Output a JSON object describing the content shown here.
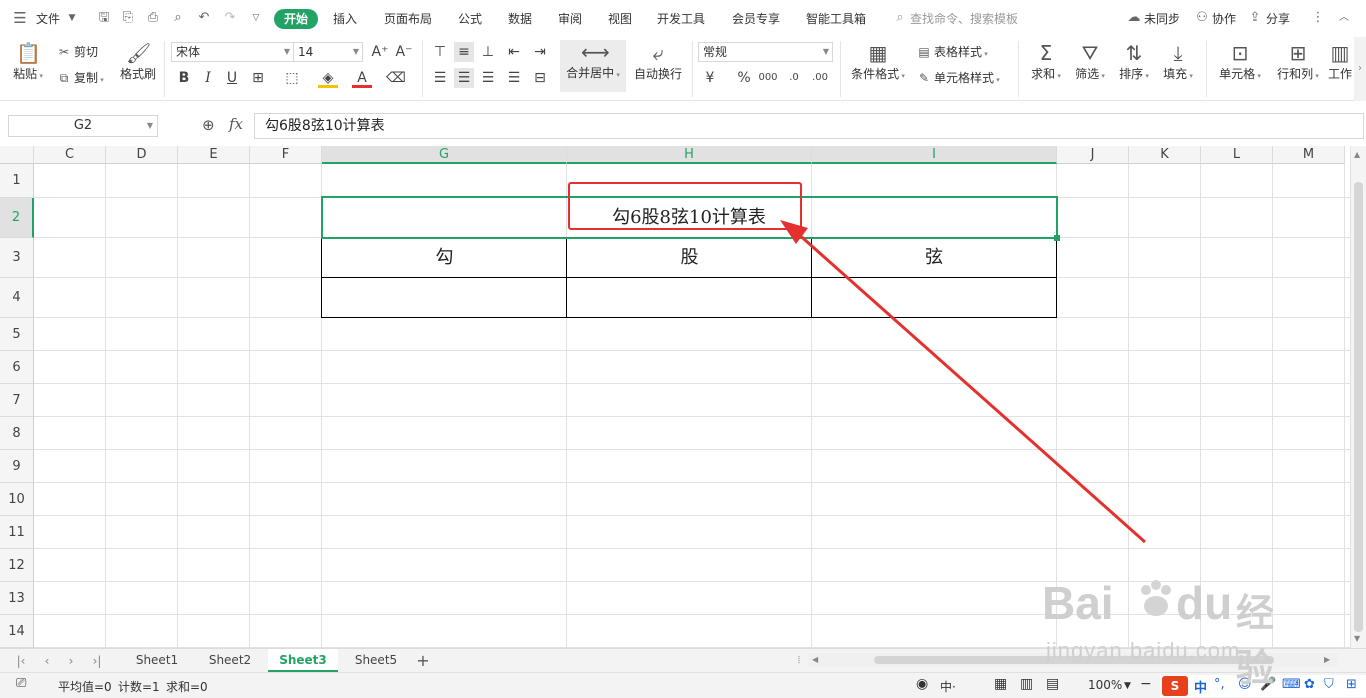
{
  "menubar": {
    "file_label": "文件",
    "tabs": [
      "开始",
      "插入",
      "页面布局",
      "公式",
      "数据",
      "审阅",
      "视图",
      "开发工具",
      "会员专享",
      "智能工具箱"
    ],
    "search_placeholder": "查找命令、搜索模板",
    "unsync_label": "未同步",
    "collab_label": "协作",
    "share_label": "分享"
  },
  "ribbon": {
    "paste": "粘贴",
    "cut": "剪切",
    "copy": "复制",
    "format_painter": "格式刷",
    "font_name": "宋体",
    "font_size": "14",
    "merge_center": "合并居中",
    "wrap_text": "自动换行",
    "number_format": "常规",
    "cond_format": "条件格式",
    "table_style": "表格样式",
    "cell_style": "单元格样式",
    "sum": "求和",
    "filter": "筛选",
    "sort": "排序",
    "fill": "填充",
    "cells": "单元格",
    "rows_cols": "行和列",
    "worksheet": "工作"
  },
  "formula_bar": {
    "cell_ref": "G2",
    "fx": "fx",
    "content": "勾6股8弦10计算表"
  },
  "grid": {
    "columns": [
      "C",
      "D",
      "E",
      "F",
      "G",
      "H",
      "I",
      "J",
      "K",
      "L",
      "M"
    ],
    "rows": [
      "1",
      "2",
      "3",
      "4",
      "5",
      "6",
      "7",
      "8",
      "9",
      "10",
      "11",
      "12",
      "13",
      "14"
    ],
    "title_cell": "勾6股8弦10计算表",
    "headers": [
      "勾",
      "股",
      "弦"
    ]
  },
  "sheets": {
    "tabs": [
      "Sheet1",
      "Sheet2",
      "Sheet3",
      "Sheet5"
    ],
    "active": "Sheet3"
  },
  "status": {
    "average": "平均值=0",
    "count": "计数=1",
    "sum": "求和=0",
    "zoom": "100%"
  },
  "watermark": {
    "brand": "Bai",
    "brand2": "du",
    "cn": "经验",
    "url": "jingyan.baidu.com"
  },
  "colors": {
    "accent": "#21a366",
    "annotation": "#e53030"
  }
}
